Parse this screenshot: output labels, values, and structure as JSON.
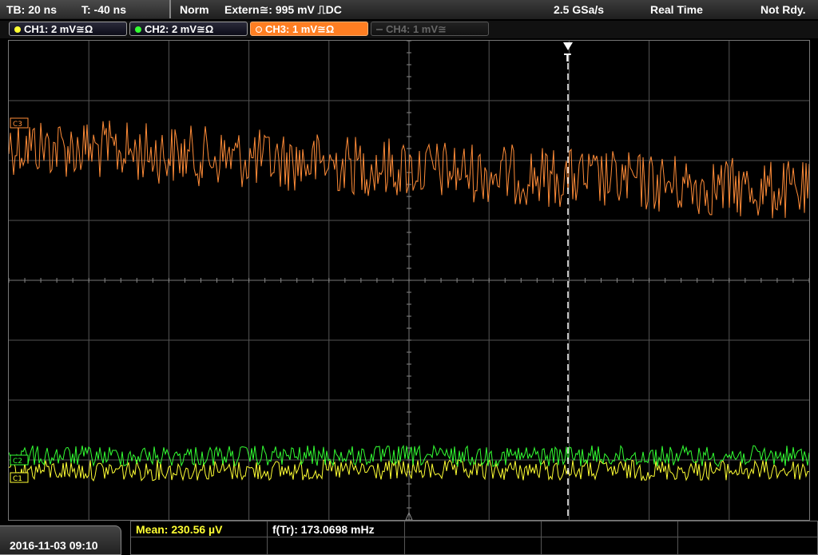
{
  "status": {
    "timebase": "TB: 20 ns",
    "trigger_time": "T: -40 ns",
    "mode": "Norm",
    "trigger_source": "Extern≅: 995 mV ⎍DC",
    "sample_rate": "2.5 GSa/s",
    "acq_mode": "Real Time",
    "state": "Not Rdy."
  },
  "channels": [
    {
      "label": "CH1: 2 mV≅Ω",
      "color": "#ffff33",
      "active": false,
      "enabled": true
    },
    {
      "label": "CH2: 2 mV≅Ω",
      "color": "#33ff33",
      "active": false,
      "enabled": true
    },
    {
      "label": "CH3: 1 mV≅Ω",
      "color": "#ff8c38",
      "active": true,
      "enabled": true
    },
    {
      "label": "CH4: 1 mV≅",
      "color": "#666666",
      "active": false,
      "enabled": false
    }
  ],
  "markers": {
    "ch3": "C3",
    "ch2": "C2",
    "ch1": "C1",
    "trigger": "T"
  },
  "measurements": {
    "mean": "Mean: 230.56 µV",
    "freq": "f(Tr): 173.0698 mHz"
  },
  "datetime": "2016-11-03 09:10",
  "colors": {
    "ch1": "#ffff33",
    "ch2": "#33ff33",
    "ch3": "#ff8c38",
    "grid": "#555555"
  }
}
